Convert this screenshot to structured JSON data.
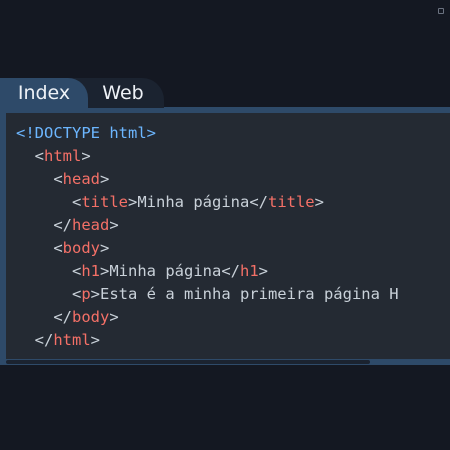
{
  "tabs": [
    {
      "label": "Index",
      "active": true
    },
    {
      "label": "Web",
      "active": false
    }
  ],
  "colors": {
    "background": "#141822",
    "editor_frame": "#2e4a69",
    "code_background": "#242a33",
    "doctype": "#6cb6ff",
    "tag": "#f47067",
    "text": "#c9d1d9"
  },
  "code": {
    "lines": [
      [
        {
          "t": "<!DOCTYPE html>",
          "c": "blue"
        }
      ],
      [
        {
          "t": "  <",
          "c": "text"
        },
        {
          "t": "html",
          "c": "red"
        },
        {
          "t": ">",
          "c": "text"
        }
      ],
      [
        {
          "t": "    <",
          "c": "text"
        },
        {
          "t": "head",
          "c": "red"
        },
        {
          "t": ">",
          "c": "text"
        }
      ],
      [
        {
          "t": "      <",
          "c": "text"
        },
        {
          "t": "title",
          "c": "red"
        },
        {
          "t": ">Minha página</",
          "c": "text"
        },
        {
          "t": "title",
          "c": "red"
        },
        {
          "t": ">",
          "c": "text"
        }
      ],
      [
        {
          "t": "    </",
          "c": "text"
        },
        {
          "t": "head",
          "c": "red"
        },
        {
          "t": ">",
          "c": "text"
        }
      ],
      [
        {
          "t": "    <",
          "c": "text"
        },
        {
          "t": "body",
          "c": "red"
        },
        {
          "t": ">",
          "c": "text"
        }
      ],
      [
        {
          "t": "      <",
          "c": "text"
        },
        {
          "t": "h1",
          "c": "red"
        },
        {
          "t": ">Minha página</",
          "c": "text"
        },
        {
          "t": "h1",
          "c": "red"
        },
        {
          "t": ">",
          "c": "text"
        }
      ],
      [
        {
          "t": "      <",
          "c": "text"
        },
        {
          "t": "p",
          "c": "red"
        },
        {
          "t": ">Esta é a minha primeira página H",
          "c": "text"
        }
      ],
      [
        {
          "t": "    </",
          "c": "text"
        },
        {
          "t": "body",
          "c": "red"
        },
        {
          "t": ">",
          "c": "text"
        }
      ],
      [
        {
          "t": "  </",
          "c": "text"
        },
        {
          "t": "html",
          "c": "red"
        },
        {
          "t": ">",
          "c": "text"
        }
      ]
    ]
  },
  "icons": {
    "corner": "square-outline-icon"
  }
}
